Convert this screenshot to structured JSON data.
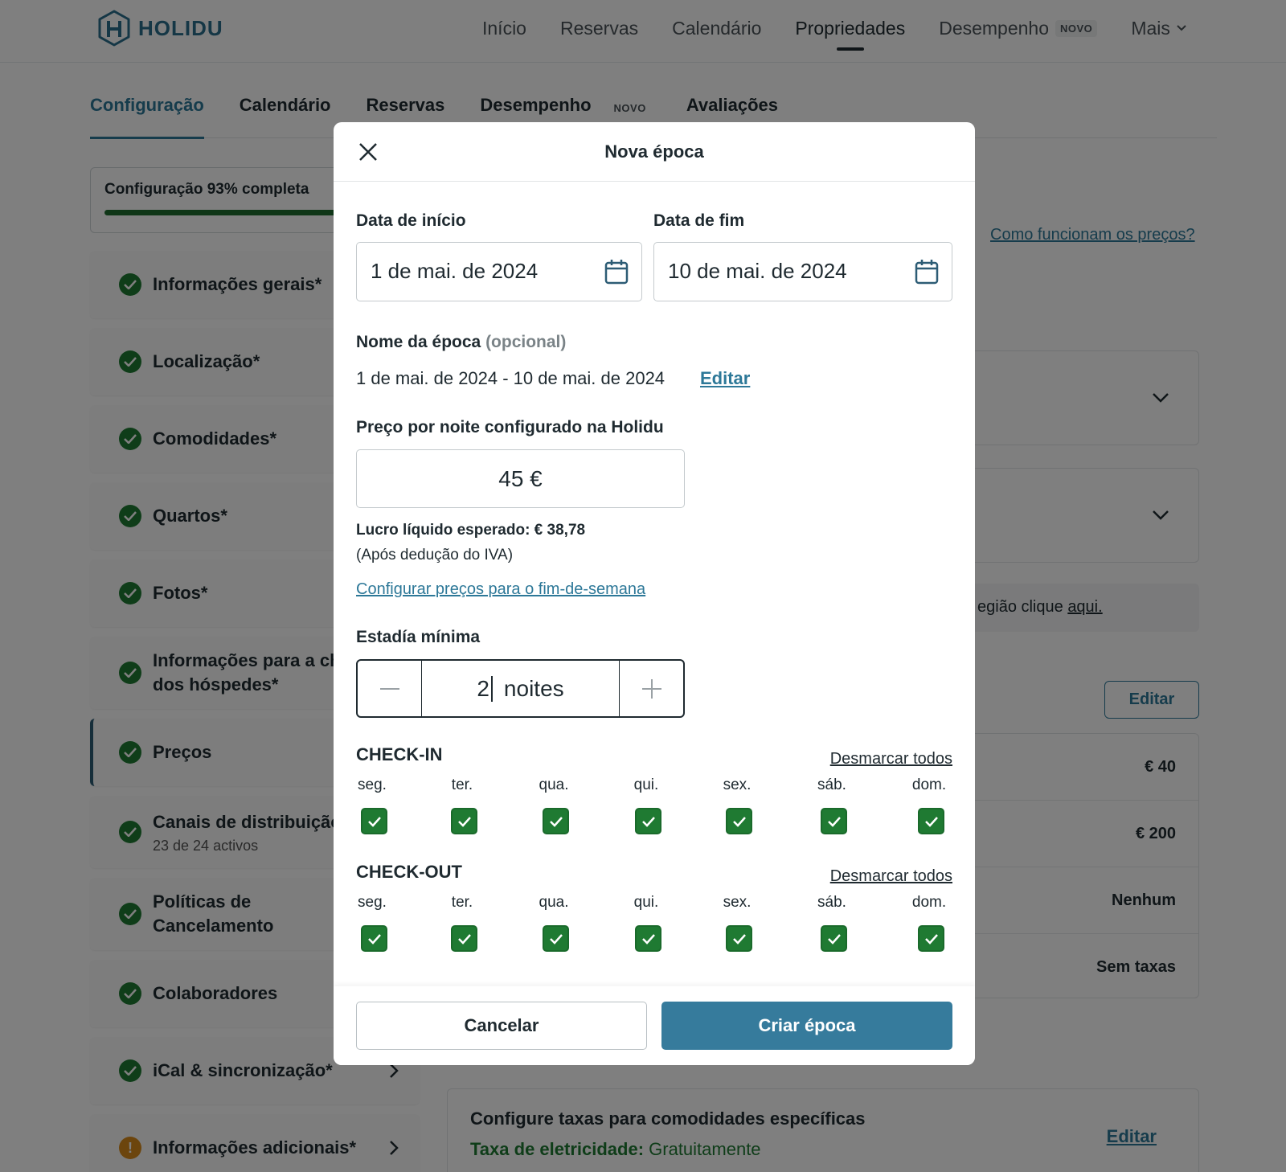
{
  "brand": {
    "name": "HOLIDU",
    "color": "#2a6e8c"
  },
  "topnav": {
    "items": [
      {
        "label": "Início"
      },
      {
        "label": "Reservas"
      },
      {
        "label": "Calendário"
      },
      {
        "label": "Propriedades"
      },
      {
        "label": "Desempenho",
        "badge": "NOVO"
      },
      {
        "label": "Mais"
      }
    ],
    "active": "Propriedades"
  },
  "subtabs": {
    "items": [
      {
        "label": "Configuração"
      },
      {
        "label": "Calendário"
      },
      {
        "label": "Reservas"
      },
      {
        "label": "Desempenho",
        "badge": "NOVO"
      },
      {
        "label": "Avaliações"
      }
    ],
    "active": "Configuração"
  },
  "progress": {
    "text": "Configuração 93% completa",
    "percent": 93
  },
  "sidebar": {
    "items": [
      {
        "label": "Informações gerais*"
      },
      {
        "label": "Localização*"
      },
      {
        "label": "Comodidades*"
      },
      {
        "label": "Quartos*"
      },
      {
        "label": "Fotos*"
      },
      {
        "label": "Informações para a chegada dos hóspedes*"
      },
      {
        "label": "Preços"
      },
      {
        "label": "Canais de distribuição",
        "sub": "23 de 24 activos"
      },
      {
        "label": "Políticas de Cancelamento"
      },
      {
        "label": "Colaboradores"
      },
      {
        "label": "iCal & sincronização*"
      },
      {
        "label": "Informações adicionais*",
        "warning": "!"
      }
    ]
  },
  "background": {
    "how_prices_link": "Como funcionam os preços?",
    "region_note": "egião clique",
    "region_link": "aqui.",
    "edit_button": "Editar",
    "fees": [
      "€ 40",
      "€ 200",
      "Nenhum",
      "Sem taxas"
    ],
    "amenities_card": {
      "title": "Configure taxas para comodidades específicas",
      "fee_label": "Taxa de eletricidade:",
      "fee_value": "Gratuitamente",
      "edit": "Editar"
    }
  },
  "modal": {
    "title": "Nova época",
    "start_date_label": "Data de início",
    "start_date_value": "1 de mai. de 2024",
    "end_date_label": "Data de fim",
    "end_date_value": "10 de mai. de 2024",
    "season_name_label": "Nome da época",
    "season_name_optional": "(opcional)",
    "season_name_value": "1 de mai. de 2024 - 10 de mai. de 2024",
    "season_name_edit": "Editar",
    "price_label": "Preço por noite configurado na Holidu",
    "price_value": "45 €",
    "profit_text": "Lucro líquido esperado: € 38,78",
    "vat_text": "(Após dedução do IVA)",
    "weekend_link": "Configurar preços para o fim-de-semana",
    "min_stay_label": "Estadía mínima",
    "min_stay_value": "2",
    "min_stay_unit": "noites",
    "checkin_title": "CHECK-IN",
    "checkout_title": "CHECK-OUT",
    "uncheck_all": "Desmarcar todos",
    "days": [
      "seg.",
      "ter.",
      "qua.",
      "qui.",
      "sex.",
      "sáb.",
      "dom."
    ],
    "checkin_checked": [
      true,
      true,
      true,
      true,
      true,
      true,
      true
    ],
    "checkout_checked": [
      true,
      true,
      true,
      true,
      true,
      true,
      true
    ],
    "cancel_button": "Cancelar",
    "create_button": "Criar época"
  },
  "colors": {
    "accent": "#367b9c",
    "check_green": "#1f7a32",
    "link": "#2d7898"
  }
}
